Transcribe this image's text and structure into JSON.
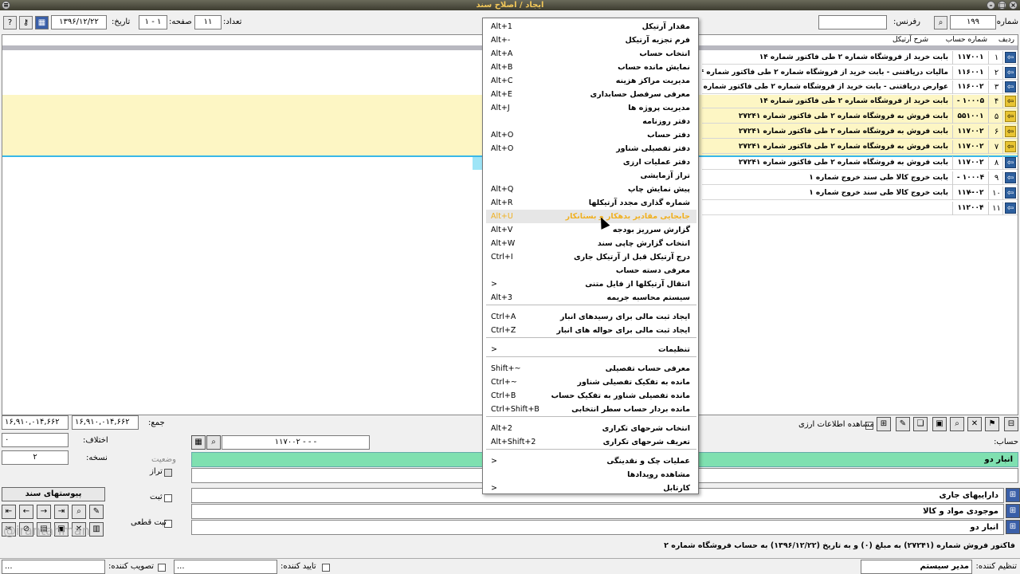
{
  "window": {
    "title": "ایجاد / اصلاح سند"
  },
  "header": {
    "doc_number_label": "شماره:",
    "doc_number": "۱۹۹",
    "ref_label": "رفرنس:",
    "ref_value": "",
    "count_label": "تعداد:",
    "count_value": "۱۱",
    "page_label": "صفحه:",
    "page_value": "۱ - ۱",
    "date_label": "تاریخ:",
    "date_value": "۱۳۹۶/۱۲/۲۲"
  },
  "grid": {
    "columns": {
      "row": "ردیف",
      "account": "شماره حساب",
      "description": "شرح آرتیکل"
    },
    "rows": [
      {
        "n": "۱",
        "acc": "۱۱۷۰۰۱",
        "desc": "بابت خرید از فروشگاه شماره ۲ طی فاکتور شماره ۱۴",
        "hl": false
      },
      {
        "n": "۲",
        "acc": "۱۱۶۰۰۱",
        "desc": "مالیات دریافتنی - بابت خرید از فروشگاه شماره ۲ طی فاکتور شماره ۱۴",
        "hl": false
      },
      {
        "n": "۳",
        "acc": "۱۱۶۰۰۲",
        "desc": "عوارض دریافتنی - بابت خرید از فروشگاه شماره ۲ طی فاکتور شماره ۱۴",
        "hl": false
      },
      {
        "n": "۴",
        "acc": "۱۰۰۰۵ - ...",
        "desc": "بابت خرید از فروشگاه شماره ۲ طی فاکتور شماره ۱۴",
        "hl": true
      },
      {
        "n": "۵",
        "acc": "۵۵۱۰۰۱",
        "desc": "بابت فروش به فروشگاه شماره ۲ طی فاکتور شماره ۲۷۲۴۱",
        "hl": true
      },
      {
        "n": "۶",
        "acc": "۱۱۷۰۰۲",
        "desc": "بابت فروش به فروشگاه شماره ۲ طی فاکتور شماره ۲۷۲۴۱",
        "hl": true
      },
      {
        "n": "۷",
        "acc": "۱۱۷۰۰۲",
        "desc": "بابت فروش به فروشگاه شماره ۲ طی فاکتور شماره ۲۷۲۴۱",
        "hl": true
      },
      {
        "n": "۸",
        "acc": "۱۱۷۰۰۲",
        "desc": "بابت فروش به فروشگاه شماره ۲ طی فاکتور شماره ۲۷۲۴۱",
        "hl": false
      },
      {
        "n": "۹",
        "acc": "۱۰۰۰۴ - ...",
        "desc": "بابت خروج کالا طی سند خروج شماره ۱",
        "hl": false
      },
      {
        "n": "۱۰",
        "acc": "۱۱۷۰۰۲",
        "desc": "بابت خروج کالا طی سند خروج شماره ۱",
        "hl": false
      },
      {
        "n": "۱۱",
        "acc": "۱۱۲۰۰۴",
        "desc": "",
        "hl": false
      }
    ]
  },
  "menu": {
    "items": [
      {
        "label": "مقدار آرتیکل",
        "shortcut": "Alt+1"
      },
      {
        "label": "فرم تجزیه آرتیکل",
        "shortcut": "Alt+-"
      },
      {
        "label": "انتخاب حساب",
        "shortcut": "Alt+A"
      },
      {
        "label": "نمایش مانده حساب",
        "shortcut": "Alt+B"
      },
      {
        "label": "مدیریت مراکز هزینه",
        "shortcut": "Alt+C"
      },
      {
        "label": "معرفی سرفصل حسابداری",
        "shortcut": "Alt+E"
      },
      {
        "label": "مدیریت پروژه ها",
        "shortcut": "Alt+J"
      },
      {
        "label": "دفتر روزنامه",
        "shortcut": ""
      },
      {
        "label": "دفتر حساب",
        "shortcut": "Alt+O"
      },
      {
        "label": "دفتر تفصیلی شناور",
        "shortcut": "Alt+O"
      },
      {
        "label": "دفتر عملیات ارزی",
        "shortcut": ""
      },
      {
        "label": "تراز آزمایشی",
        "shortcut": ""
      },
      {
        "label": "پیش نمایش چاپ",
        "shortcut": "Alt+Q"
      },
      {
        "label": "شماره گذاری مجدد آرتیکلها",
        "shortcut": "Alt+R"
      },
      {
        "label": "جابجایی مقادیر بدهکار و بستانکار",
        "shortcut": "Alt+U",
        "highlight": true
      },
      {
        "label": "گزارش سرریز بودجه",
        "shortcut": "Alt+V"
      },
      {
        "label": "انتخاب گزارش چاپی سند",
        "shortcut": "Alt+W"
      },
      {
        "label": "درج آرتیکل قبل از آرتیکل جاری",
        "shortcut": "Ctrl+I"
      },
      {
        "label": "معرفی دسته حساب",
        "shortcut": ""
      },
      {
        "label": "انتقال آرتیکلها از فایل متنی",
        "shortcut": ">"
      },
      {
        "label": "سیستم محاسبه جریمه",
        "shortcut": "Alt+3"
      },
      {
        "label": "ایجاد ثبت مالی برای رسیدهای انبار",
        "shortcut": "Ctrl+A"
      },
      {
        "label": "ایجاد ثبت مالی برای حواله های انبار",
        "shortcut": "Ctrl+Z"
      },
      {
        "label": "تنظیمات",
        "shortcut": ">"
      },
      {
        "label": "معرفی حساب تفصیلی",
        "shortcut": "Shift+~"
      },
      {
        "label": "مانده به تفکیک تفصیلی شناور",
        "shortcut": "Ctrl+~"
      },
      {
        "label": "مانده تفصیلی شناور به تفکیک حساب",
        "shortcut": "Ctrl+B"
      },
      {
        "label": "مانده بردار حساب سطر انتخابی",
        "shortcut": "Ctrl+Shift+B"
      },
      {
        "label": "انتخاب شرحهای تکراری",
        "shortcut": "Alt+2"
      },
      {
        "label": "تعریف شرحهای تکراری",
        "shortcut": "Alt+Shift+2"
      },
      {
        "label": "عملیات چک و نقدینگی",
        "shortcut": ">"
      },
      {
        "label": "مشاهده رویدادها",
        "shortcut": ""
      },
      {
        "label": "کارتابل",
        "shortcut": ">"
      }
    ]
  },
  "bottom": {
    "sum_label": "جمع:",
    "sum_debit": "۱۶,۹۱۰,۰۱۴,۶۶۲",
    "sum_credit": "۱۶,۹۱۰,۰۱۴,۶۶۲",
    "diff_label": "اختلاف:",
    "diff_value": "۰",
    "copies_label": "نسخه:",
    "copies_value": "۲",
    "status_legend": "وضعیت",
    "status_balance": "تراز",
    "status_posted": "ثبت",
    "status_final": "ثبت قطعی",
    "attachments_button": "پیوستهای سند",
    "fx_checkbox_label": "مشاهده اطلاعات ارزی",
    "account_label": "حساب:",
    "account_code": "۱۱۷۰۰۲ - - -",
    "account_name": "انبار دو",
    "tree": [
      "داراییهای جاری",
      "موجودی مواد و کالا",
      "انبار دو"
    ],
    "article_desc": "فاکتور فروش شماره (۲۷۲۴۱) به مبلغ (۰) و به تاریخ (۱۳۹۶/۱۲/۲۲) به حساب فروشگاه شماره ۲"
  },
  "footer": {
    "creator_label": "تنظیم کننده:",
    "creator_value": "مدیر سیستم",
    "confirm_label": "تایید کننده:",
    "confirm_value": "...",
    "approve_label": "تصویب کننده:",
    "approve_value": "..."
  },
  "watermark": "@irantahman"
}
